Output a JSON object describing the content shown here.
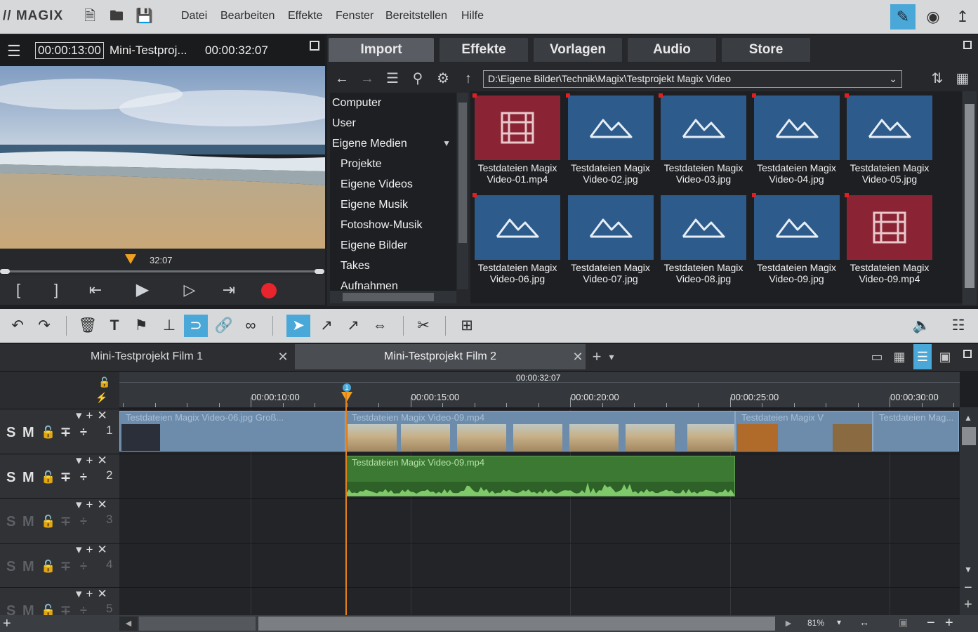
{
  "app": {
    "logo": "// MAGIX",
    "menu": [
      "Datei",
      "Bearbeiten",
      "Effekte",
      "Fenster",
      "Bereitstellen",
      "Hilfe"
    ]
  },
  "preview": {
    "timecode_position": "00:00:13:00",
    "project_name": "Mini-Testproj...",
    "timecode_length": "00:00:32:07",
    "scrub_label": "32:07"
  },
  "media_pool": {
    "tabs": [
      "Import",
      "Effekte",
      "Vorlagen",
      "Audio",
      "Store"
    ],
    "active_tab": "Import",
    "path": "D:\\Eigene Bilder\\Technik\\Magix\\Testprojekt Magix Video",
    "tree": [
      {
        "label": "Computer",
        "indent": 0
      },
      {
        "label": "User",
        "indent": 0
      },
      {
        "label": "Eigene Medien",
        "indent": 0
      },
      {
        "label": "Projekte",
        "indent": 1
      },
      {
        "label": "Eigene Videos",
        "indent": 1
      },
      {
        "label": "Eigene Musik",
        "indent": 1
      },
      {
        "label": "Fotoshow-Musik",
        "indent": 1
      },
      {
        "label": "Eigene Bilder",
        "indent": 1
      },
      {
        "label": "Takes",
        "indent": 1
      },
      {
        "label": "Aufnahmen",
        "indent": 1
      }
    ],
    "files": [
      {
        "line1": "Testdateien Magix",
        "line2": "Video-01.mp4",
        "kind": "video"
      },
      {
        "line1": "Testdateien Magix",
        "line2": "Video-02.jpg",
        "kind": "image"
      },
      {
        "line1": "Testdateien Magix",
        "line2": "Video-03.jpg",
        "kind": "image"
      },
      {
        "line1": "Testdateien Magix",
        "line2": "Video-04.jpg",
        "kind": "image"
      },
      {
        "line1": "Testdateien Magix",
        "line2": "Video-05.jpg",
        "kind": "image"
      },
      {
        "line1": "Testdateien Magix",
        "line2": "Video-06.jpg",
        "kind": "image"
      },
      {
        "line1": "Testdateien Magix",
        "line2": "Video-07.jpg",
        "kind": "image"
      },
      {
        "line1": "Testdateien Magix",
        "line2": "Video-08.jpg",
        "kind": "image"
      },
      {
        "line1": "Testdateien Magix",
        "line2": "Video-09.jpg",
        "kind": "image"
      },
      {
        "line1": "Testdateien Magix",
        "line2": "Video-09.mp4",
        "kind": "video"
      }
    ]
  },
  "project_tabs": [
    "Mini-Testprojekt Film 1",
    "Mini-Testprojekt Film 2"
  ],
  "timeline": {
    "ruler_total": "00:00:32:07",
    "ruler_labels": [
      "00:00:10:00",
      "00:00:15:00",
      "00:00:20:00",
      "00:00:25:00",
      "00:00:30:00"
    ],
    "marker": "1",
    "tracks": [
      {
        "number": "1",
        "s": "S",
        "m": "M",
        "dim": false
      },
      {
        "number": "2",
        "s": "S",
        "m": "M",
        "dim": false
      },
      {
        "number": "3",
        "s": "S",
        "m": "M",
        "dim": true
      },
      {
        "number": "4",
        "s": "S",
        "m": "M",
        "dim": true
      },
      {
        "number": "5",
        "s": "S",
        "m": "M",
        "dim": true
      }
    ],
    "clips": {
      "c1": "Testdateien Magix Video-06.jpg   Groß...",
      "c2": "Testdateien Magix Video-09.mp4",
      "c3": "Testdateien Magix V",
      "c4": "Testdateien Mag...",
      "audio": "Testdateien Magix Video-09.mp4"
    },
    "zoom": "81%"
  },
  "colors": {
    "accent": "#4aa8d8",
    "video_tile": "#8a2434",
    "image_tile": "#2d5b8c",
    "playhead": "#e3801c",
    "record": "#e8242c"
  }
}
